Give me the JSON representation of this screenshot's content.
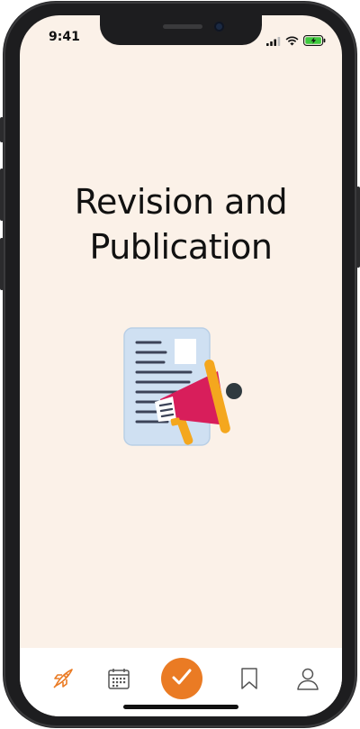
{
  "status_bar": {
    "time": "9:41"
  },
  "main": {
    "title": "Revision and\nPublication"
  },
  "illustration": {
    "icon": "document-megaphone-icon"
  },
  "tabbar": {
    "items": [
      {
        "icon": "rocket-icon",
        "active": true
      },
      {
        "icon": "calendar-icon",
        "active": false
      },
      {
        "icon": "check-icon",
        "active": false,
        "highlight": true
      },
      {
        "icon": "bookmark-icon",
        "active": false
      },
      {
        "icon": "profile-icon",
        "active": false
      }
    ]
  },
  "colors": {
    "background": "#fbf1e8",
    "accent": "#ea7b24",
    "megaphone": "#d81e5b",
    "document": "#cfe0f2"
  }
}
